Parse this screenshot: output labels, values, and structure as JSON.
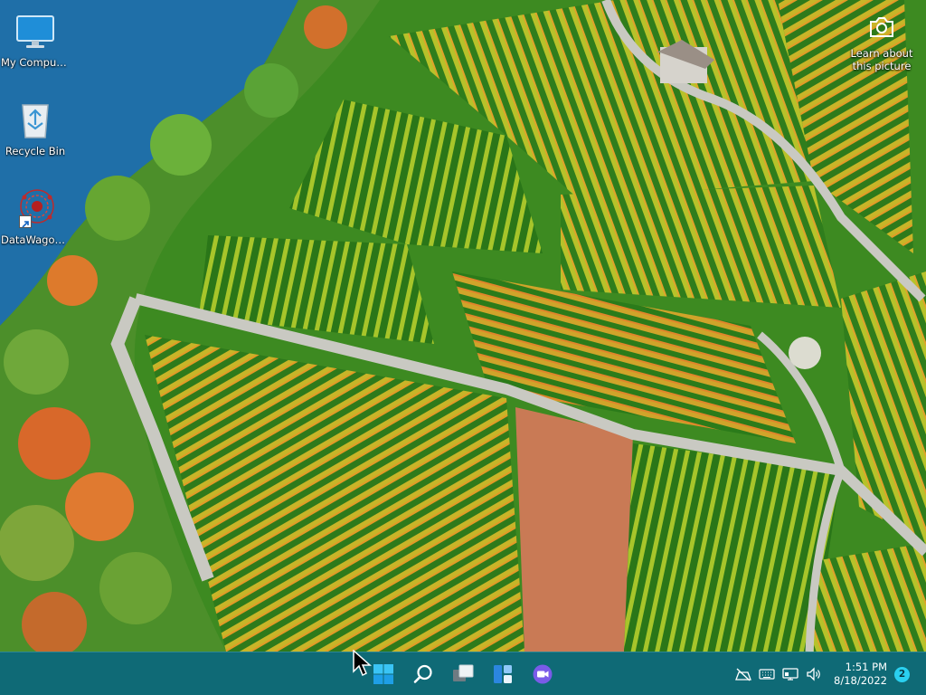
{
  "desktop": {
    "icons": [
      {
        "label": "My Computer",
        "icon": "monitor-icon"
      },
      {
        "label": "Recycle Bin",
        "icon": "recycle-bin-icon"
      },
      {
        "label": "DataWagon...",
        "icon": "datawagon-icon",
        "shortcut": true
      }
    ],
    "spotlight": {
      "label": "Learn about this picture",
      "icon": "camera-icon"
    }
  },
  "taskbar": {
    "apps": [
      {
        "name": "start",
        "icon": "windows-logo-icon"
      },
      {
        "name": "search",
        "icon": "search-icon"
      },
      {
        "name": "task-view",
        "icon": "task-view-icon"
      },
      {
        "name": "widgets",
        "icon": "widgets-icon"
      },
      {
        "name": "chat",
        "icon": "chat-icon"
      }
    ],
    "tray": {
      "icons": [
        "network-off-icon",
        "keyboard-icon",
        "display-icon",
        "speaker-icon"
      ],
      "time": "1:51 PM",
      "date": "8/18/2022",
      "notification_count": "2"
    }
  },
  "colors": {
    "taskbar": "#0f6a76",
    "lake": "#1f6fa8",
    "notification_badge": "#2ad0f0"
  }
}
